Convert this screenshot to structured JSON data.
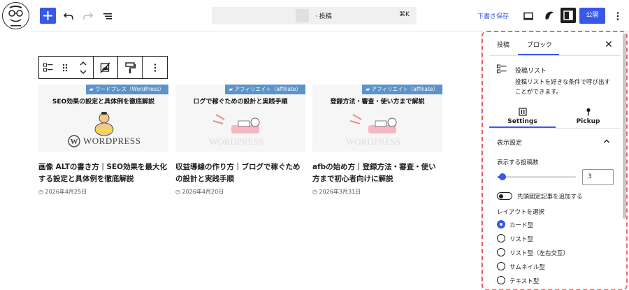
{
  "topbar": {
    "add_icon": "plus",
    "command_text": "· 投稿",
    "command_shortcut": "⌘K",
    "save_draft": "下書き保存",
    "publish": "公開"
  },
  "block_toolbar": {
    "icons": [
      "post-list-icon",
      "drag-handle-icon",
      "move-up-down-icon",
      "image-toggle-icon",
      "block-style-icon",
      "more-options-icon"
    ]
  },
  "cards": [
    {
      "category": "ワードプレス（WordPress）",
      "thumb_title": "SEO効果の設定と具体例を徹底解説",
      "thumb_logo": "WORDPRESS",
      "title": "画像 ALTの書き方｜SEO効果を最大化する設定と具体例を徹底解説",
      "date": "2026年4月25日"
    },
    {
      "category": "アフィリエイト（affiliate）",
      "thumb_title": "ログで稼ぐための設計と実践手順",
      "thumb_logo": "WORDPRESS",
      "title": "収益導線の作り方｜ブログで稼ぐための設計と実践手順",
      "date": "2026年4月20日"
    },
    {
      "category": "アフィリエイト（affiliate）",
      "thumb_title": "登録方法・審査・使い方まで解説",
      "thumb_logo": "WORDPRESS",
      "title": "afbの始め方｜登録方法・審査・使い方まで初心者向けに解説",
      "date": "2026年3月31日"
    }
  ],
  "sidebar": {
    "tab_post": "投稿",
    "tab_block": "ブロック",
    "block_name": "投稿リスト",
    "block_desc": "投稿リストを好きな条件で呼び出すことができます。",
    "subtab_settings": "Settings",
    "subtab_pickup": "Pickup",
    "panel_title": "表示設定",
    "post_count_label": "表示する投稿数",
    "post_count_value": "3",
    "post_count_fraction": 0.06,
    "sticky_label": "先頭固定記事を追加する",
    "sticky_on": false,
    "layout_label": "レイアウトを選択",
    "layouts": [
      {
        "label": "カード型",
        "selected": true
      },
      {
        "label": "リスト型",
        "selected": false
      },
      {
        "label": "リスト型（左右交互）",
        "selected": false
      },
      {
        "label": "サムネイル型",
        "selected": false
      },
      {
        "label": "テキスト型",
        "selected": false
      }
    ]
  },
  "colors": {
    "accent": "#3858e9",
    "category_badge": "#5c93c9",
    "highlight_border": "#e86a6a"
  }
}
